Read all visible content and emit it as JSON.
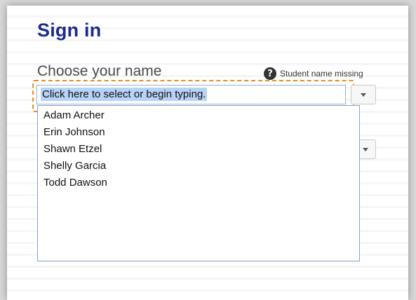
{
  "header": {
    "title": "Sign in"
  },
  "name_field": {
    "label": "Choose your name",
    "help_icon": "question-circle-icon",
    "missing_link": "Student name missing",
    "value": "Click here to select or begin typing.",
    "dropdown_icon": "caret-down-icon"
  },
  "name_options": [
    "Adam Archer",
    "Erin Johnson",
    "Shawn Etzel",
    "Shelly Garcia",
    "Todd Dawson"
  ],
  "second_field": {
    "dropdown_icon": "caret-down-icon"
  },
  "colors": {
    "title": "#1c2a8f",
    "focus_ring": "#f08a1c",
    "selection": "#b7d3f7",
    "list_border": "#7fa0d4"
  }
}
